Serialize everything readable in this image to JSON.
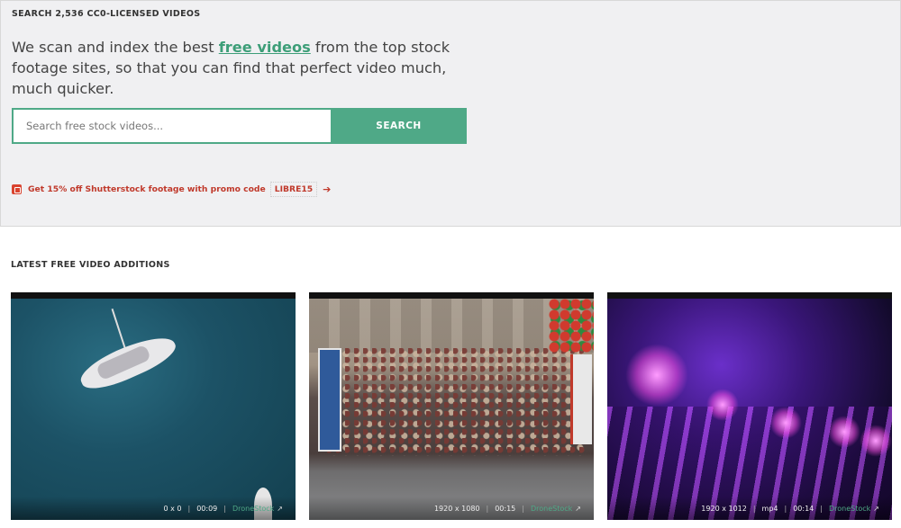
{
  "hero": {
    "eyebrow": "SEARCH 2,536 CC0-LICENSED VIDEOS",
    "tagline_part1": "We scan and index the best ",
    "tagline_link": "free videos",
    "tagline_part2": " from the top stock footage sites, so that you can find that perfect video much, much quicker."
  },
  "search": {
    "placeholder": "Search free stock videos...",
    "button_label": "SEARCH"
  },
  "promo": {
    "text": "Get 15% off Shutterstock footage with promo code",
    "code": "LIBRE15",
    "arrow": "➔"
  },
  "latest": {
    "title": "LATEST FREE VIDEO ADDITIONS",
    "videos": [
      {
        "resolution": "0 x 0",
        "duration": "00:09",
        "source": "DroneStock",
        "icon": "external-link-icon"
      },
      {
        "resolution": "1920 x 1080",
        "duration": "00:15",
        "source": "DroneStock",
        "icon": "external-link-icon"
      },
      {
        "resolution": "1920 x 1012",
        "format": "mp4",
        "duration": "00:14",
        "source": "DroneStock",
        "icon": "external-link-icon"
      }
    ]
  },
  "colors": {
    "accent": "#4fa987",
    "promo": "#c0392b"
  }
}
